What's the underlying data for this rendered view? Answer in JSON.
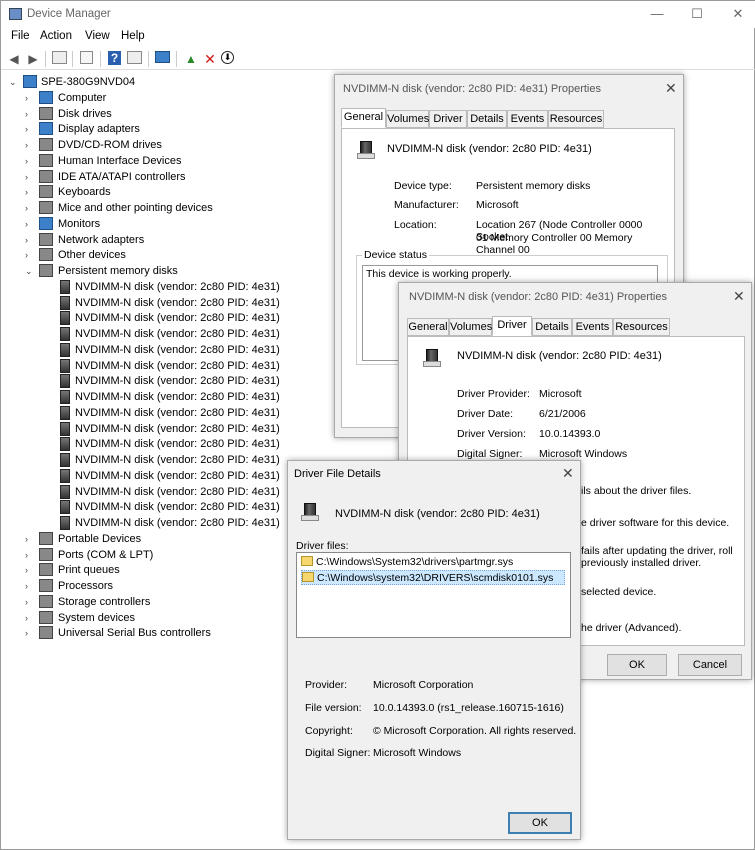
{
  "window": {
    "title": "Device Manager",
    "controls": {
      "minimize": "—",
      "maximize": "☐",
      "close": "✕"
    }
  },
  "menu": [
    "File",
    "Action",
    "View",
    "Help"
  ],
  "toolbar": {
    "icons": [
      "back-icon",
      "forward-icon",
      "properties-icon",
      "show-hidden-icon",
      "help-icon",
      "action-icon",
      "monitor-icon",
      "update-driver-icon",
      "uninstall-icon",
      "scan-icon"
    ]
  },
  "tree": {
    "root": "SPE-380G9NVD04",
    "categories_before": [
      "Computer",
      "Disk drives",
      "Display adapters",
      "DVD/CD-ROM drives",
      "Human Interface Devices",
      "IDE ATA/ATAPI controllers",
      "Keyboards",
      "Mice and other pointing devices",
      "Monitors",
      "Network adapters",
      "Other devices"
    ],
    "expanded": "Persistent memory disks",
    "children": [
      "NVDIMM-N disk (vendor: 2c80 PID: 4e31)",
      "NVDIMM-N disk (vendor: 2c80 PID: 4e31)",
      "NVDIMM-N disk (vendor: 2c80 PID: 4e31)",
      "NVDIMM-N disk (vendor: 2c80 PID: 4e31)",
      "NVDIMM-N disk (vendor: 2c80 PID: 4e31)",
      "NVDIMM-N disk (vendor: 2c80 PID: 4e31)",
      "NVDIMM-N disk (vendor: 2c80 PID: 4e31)",
      "NVDIMM-N disk (vendor: 2c80 PID: 4e31)",
      "NVDIMM-N disk (vendor: 2c80 PID: 4e31)",
      "NVDIMM-N disk (vendor: 2c80 PID: 4e31)",
      "NVDIMM-N disk (vendor: 2c80 PID: 4e31)",
      "NVDIMM-N disk (vendor: 2c80 PID: 4e31)",
      "NVDIMM-N disk (vendor: 2c80 PID: 4e31)",
      "NVDIMM-N disk (vendor: 2c80 PID: 4e31)",
      "NVDIMM-N disk (vendor: 2c80 PID: 4e31)",
      "NVDIMM-N disk (vendor: 2c80 PID: 4e31)"
    ],
    "categories_after": [
      "Portable Devices",
      "Ports (COM & LPT)",
      "Print queues",
      "Processors",
      "Storage controllers",
      "System devices",
      "Universal Serial Bus controllers"
    ]
  },
  "props1": {
    "title": "NVDIMM-N disk (vendor: 2c80 PID: 4e31) Properties",
    "close": "✕",
    "tabs": [
      "General",
      "Volumes",
      "Driver",
      "Details",
      "Events",
      "Resources"
    ],
    "device_name": "NVDIMM-N disk (vendor: 2c80 PID: 4e31)",
    "device_type_label": "Device type:",
    "device_type": "Persistent memory disks",
    "manufacturer_label": "Manufacturer:",
    "manufacturer": "Microsoft",
    "location_label": "Location:",
    "location_line1": "Location 267 (Node Controller 0000 Socket",
    "location_line2": "01 Memory Controller 00 Memory Channel 00",
    "status_group": "Device status",
    "status_text": "This device is working properly."
  },
  "props2": {
    "title": "NVDIMM-N disk (vendor: 2c80 PID: 4e31) Properties",
    "close": "✕",
    "tabs": [
      "General",
      "Volumes",
      "Driver",
      "Details",
      "Events",
      "Resources"
    ],
    "device_name": "NVDIMM-N disk (vendor: 2c80 PID: 4e31)",
    "provider_label": "Driver Provider:",
    "provider": "Microsoft",
    "date_label": "Driver Date:",
    "date": "6/21/2006",
    "version_label": "Driver Version:",
    "version": "10.0.14393.0",
    "signer_label": "Digital Signer:",
    "signer": "Microsoft Windows",
    "desc_details": "ils about the driver files.",
    "desc_update": "e driver software for this device.",
    "desc_rollback1": "fails after updating the driver, roll",
    "desc_rollback2": "previously installed driver.",
    "desc_disable": "selected device.",
    "desc_uninstall": "he driver (Advanced).",
    "ok": "OK",
    "cancel": "Cancel"
  },
  "filedetails": {
    "title": "Driver File Details",
    "close": "✕",
    "device_name": "NVDIMM-N disk (vendor: 2c80 PID: 4e31)",
    "files_label": "Driver files:",
    "files": [
      "C:\\Windows\\System32\\drivers\\partmgr.sys",
      "C:\\Windows\\system32\\DRIVERS\\scmdisk0101.sys"
    ],
    "provider_label": "Provider:",
    "provider": "Microsoft Corporation",
    "version_label": "File version:",
    "version": "10.0.14393.0 (rs1_release.160715-1616)",
    "copyright_label": "Copyright:",
    "copyright": "© Microsoft Corporation. All rights reserved.",
    "signer_label": "Digital Signer:",
    "signer": "Microsoft Windows",
    "ok": "OK"
  },
  "colors": {
    "accent": "#3c7fb1",
    "selection": "#cce8ff"
  }
}
